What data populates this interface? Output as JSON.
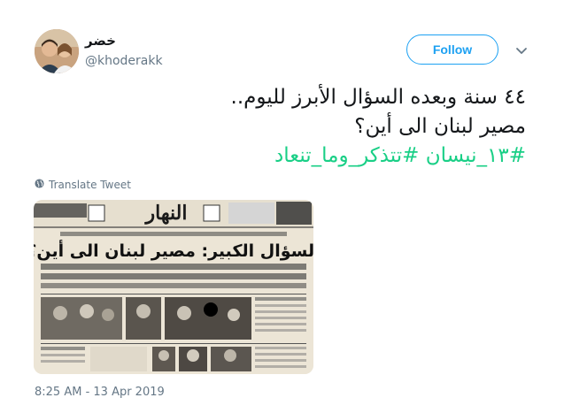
{
  "author": {
    "display_name": "خضر",
    "handle": "@khoderakk",
    "avatar_icon": "user-avatar"
  },
  "follow_button": {
    "label": "Follow",
    "color": "#1da1f2"
  },
  "more_menu": {
    "icon": "chevron-down-icon"
  },
  "tweet": {
    "line1": "٤٤ سنة وبعده السؤال الأبرز لليوم..",
    "line2": "مصير لبنان الى أين؟",
    "hashtags": [
      "#١٣_نيسان",
      "#تتذكر_وما_تنعاد"
    ],
    "hashtag_color": "#19cf86"
  },
  "translate": {
    "label": "Translate Tweet",
    "icon": "globe-icon"
  },
  "media": {
    "type": "newspaper-photo",
    "masthead": "النهار",
    "headline": "السؤال الكبير: مصير لبنان الى أين؟"
  },
  "timestamp": "8:25 AM - 13 Apr 2019"
}
